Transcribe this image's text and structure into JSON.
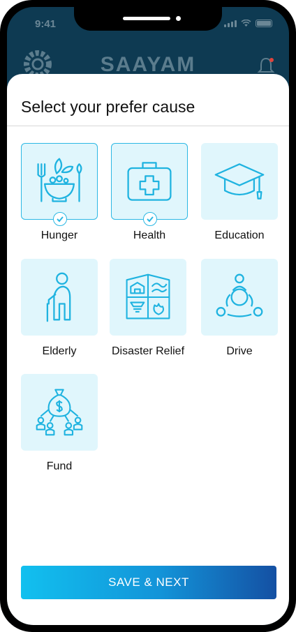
{
  "status_bar": {
    "time": "9:41"
  },
  "app_bar": {
    "title": "SAAYAM",
    "logo_icon": "sun-logo-icon",
    "bell_icon": "bell-icon"
  },
  "sheet": {
    "title": "Select your prefer cause",
    "causes": [
      {
        "label": "Hunger",
        "icon": "food-bowl-icon",
        "selected": true
      },
      {
        "label": "Health",
        "icon": "first-aid-kit-icon",
        "selected": true
      },
      {
        "label": "Education",
        "icon": "graduation-cap-icon",
        "selected": false
      },
      {
        "label": "Elderly",
        "icon": "elderly-person-icon",
        "selected": false
      },
      {
        "label": "Disaster Relief",
        "icon": "disaster-icon",
        "selected": false
      },
      {
        "label": "Drive",
        "icon": "community-drive-icon",
        "selected": false
      },
      {
        "label": "Fund",
        "icon": "money-bag-icon",
        "selected": false
      }
    ],
    "save_label": "SAVE & NEXT"
  },
  "colors": {
    "accent": "#2bb8e4",
    "tile_bg": "#e0f6fc",
    "header_bg": "#0e3a52",
    "button_gradient": [
      "#12c0ef",
      "#1450a3"
    ]
  }
}
